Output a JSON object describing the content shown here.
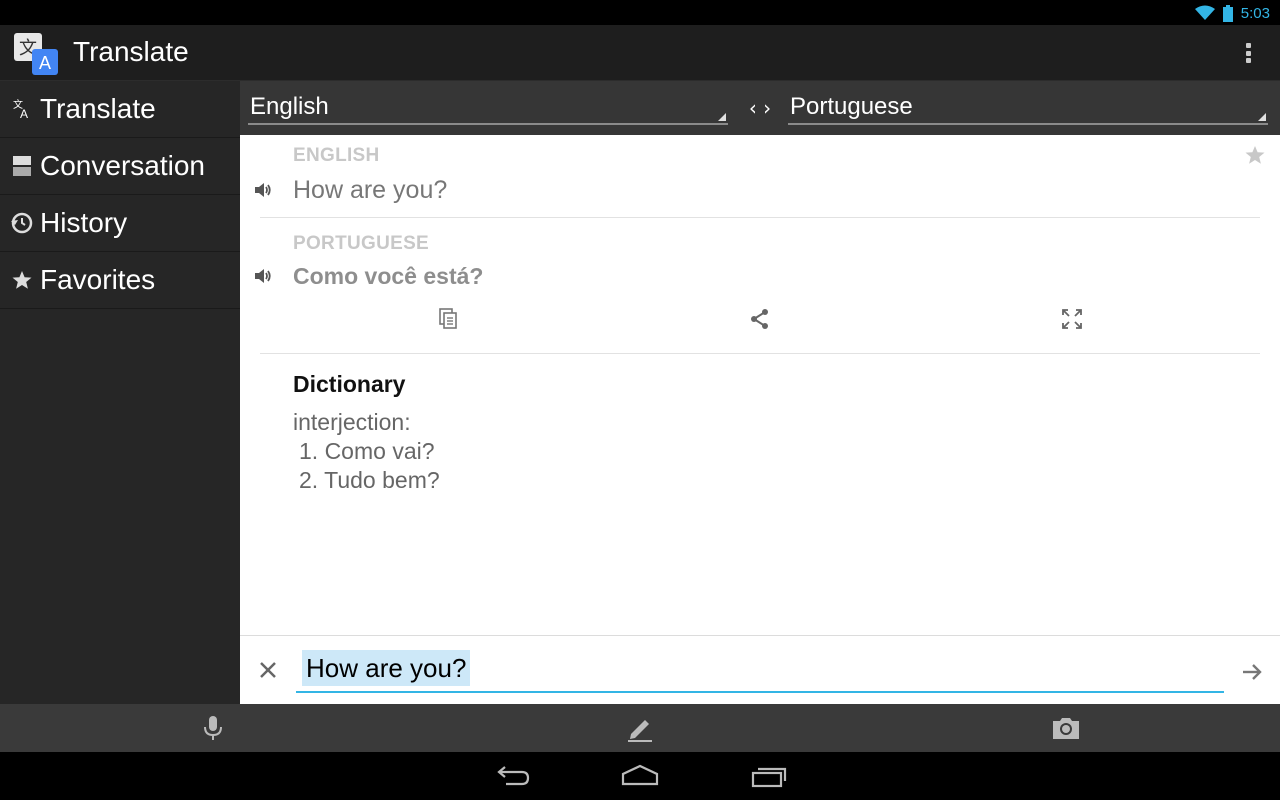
{
  "status_bar": {
    "time": "5:03",
    "icons": [
      "wifi-icon",
      "battery-icon"
    ],
    "accent_color": "#33b5e5"
  },
  "action_bar": {
    "app_title": "Translate",
    "app_icon": "translate-app-icon",
    "overflow_icon": "overflow-menu-icon"
  },
  "sidebar": {
    "items": [
      {
        "label": "Translate",
        "icon": "translate-icon"
      },
      {
        "label": "Conversation",
        "icon": "conversation-icon"
      },
      {
        "label": "History",
        "icon": "history-icon"
      },
      {
        "label": "Favorites",
        "icon": "star-icon"
      }
    ]
  },
  "language_bar": {
    "source_language": "English",
    "target_language": "Portuguese",
    "swap_label": "‹ ›"
  },
  "result": {
    "source_label": "ENGLISH",
    "source_text": "How are you?",
    "target_label": "PORTUGUESE",
    "target_text": "Como você está?",
    "actions": [
      "copy-icon",
      "share-icon",
      "fullscreen-icon"
    ]
  },
  "dictionary": {
    "title": "Dictionary",
    "part_of_speech": "interjection:",
    "entries": [
      "1. Como vai?",
      "2. Tudo bem?"
    ]
  },
  "input": {
    "value": "How are you?",
    "focus_color": "#33b5e5"
  },
  "toolbar": {
    "buttons": [
      "microphone-icon",
      "handwriting-icon",
      "camera-icon"
    ]
  },
  "nav_bar": {
    "buttons": [
      "back-icon",
      "home-icon",
      "recent-apps-icon"
    ]
  }
}
